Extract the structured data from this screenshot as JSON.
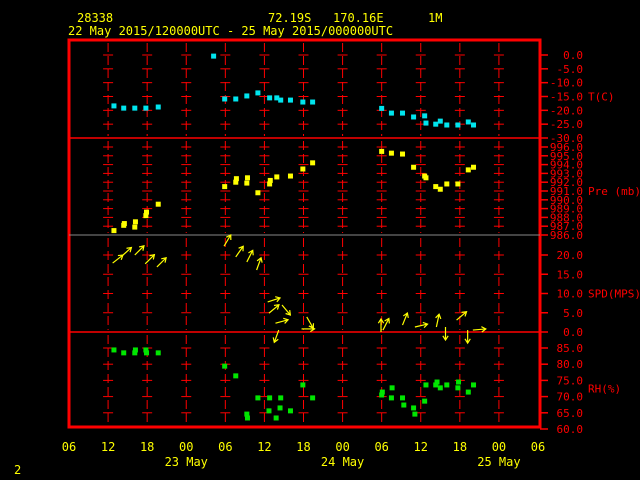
{
  "header": {
    "station": "28338",
    "lat": "72.19S",
    "lon": "170.16E",
    "level": "1M",
    "period": "22 May 2015/120000UTC - 25 May 2015/000000UTC"
  },
  "footer": {
    "page": "2"
  },
  "colors": {
    "frame": "#ff0000",
    "text": "#ffff00",
    "temp": "#00e5ee",
    "pres": "#ffff00",
    "wind": "#ffff00",
    "rh": "#00e600"
  },
  "chart_data": {
    "type": "scatter",
    "x_unit": "hours since 22 May 2015 06UTC",
    "x_range": [
      0,
      72
    ],
    "x_tick_labels": [
      "06",
      "12",
      "18",
      "00",
      "06",
      "12",
      "18",
      "00",
      "06",
      "12",
      "18",
      "00",
      "06"
    ],
    "date_labels": [
      {
        "label": "23 May",
        "hour": 18
      },
      {
        "label": "24 May",
        "hour": 42
      },
      {
        "label": "25 May",
        "hour": 66
      }
    ],
    "panels": [
      {
        "name": "temperature",
        "title": "T(C)",
        "range": [
          -30,
          0
        ],
        "ticks": [
          0,
          -5,
          -10,
          -15,
          -20,
          -25,
          -30
        ],
        "tick_labels": [
          "0.0",
          "-5.0",
          "-10.0",
          "-15.0",
          "-20.0",
          "-25.0",
          "-30.0"
        ],
        "points": [
          [
            6.9,
            -18.4
          ],
          [
            8.4,
            -19.2
          ],
          [
            10.1,
            -19.2
          ],
          [
            11.8,
            -19.2
          ],
          [
            13.7,
            -18.8
          ],
          [
            22.2,
            -0.4
          ],
          [
            23.9,
            -15.9
          ],
          [
            25.6,
            -15.9
          ],
          [
            27.3,
            -14.8
          ],
          [
            29.0,
            -13.7
          ],
          [
            30.8,
            -15.5
          ],
          [
            31.9,
            -15.5
          ],
          [
            32.5,
            -16.3
          ],
          [
            34.0,
            -16.3
          ],
          [
            35.9,
            -17.0
          ],
          [
            37.4,
            -17.0
          ],
          [
            48.0,
            -19.3
          ],
          [
            49.5,
            -21.0
          ],
          [
            51.2,
            -21.0
          ],
          [
            52.9,
            -22.4
          ],
          [
            54.6,
            -22.0
          ],
          [
            54.8,
            -24.6
          ],
          [
            56.3,
            -25.0
          ],
          [
            57.0,
            -23.9
          ],
          [
            58.0,
            -25.3
          ],
          [
            59.7,
            -25.3
          ],
          [
            61.3,
            -24.2
          ],
          [
            62.1,
            -25.3
          ]
        ]
      },
      {
        "name": "pressure",
        "title": "Pre (mb)",
        "range": [
          986,
          996
        ],
        "ticks": [
          996,
          995,
          994,
          993,
          992,
          991,
          990,
          989,
          988,
          987,
          986
        ],
        "tick_labels": [
          "996.0",
          "995.0",
          "994.0",
          "993.0",
          "992.0",
          "991.0",
          "990.0",
          "989.0",
          "988.0",
          "987.0",
          "986.0"
        ],
        "points": [
          [
            6.9,
            986.5
          ],
          [
            8.4,
            987.1
          ],
          [
            8.5,
            987.3
          ],
          [
            10.1,
            986.9
          ],
          [
            10.2,
            987.5
          ],
          [
            11.8,
            988.2
          ],
          [
            11.9,
            988.6
          ],
          [
            13.7,
            989.5
          ],
          [
            23.9,
            991.5
          ],
          [
            25.6,
            992.0
          ],
          [
            25.7,
            992.4
          ],
          [
            27.3,
            991.9
          ],
          [
            27.4,
            992.5
          ],
          [
            29.0,
            990.8
          ],
          [
            30.8,
            991.8
          ],
          [
            30.9,
            992.2
          ],
          [
            31.9,
            992.6
          ],
          [
            34.0,
            992.7
          ],
          [
            35.9,
            993.5
          ],
          [
            37.4,
            994.2
          ],
          [
            48.0,
            995.5
          ],
          [
            49.5,
            995.3
          ],
          [
            51.2,
            995.2
          ],
          [
            52.9,
            993.7
          ],
          [
            54.6,
            992.7
          ],
          [
            54.8,
            992.5
          ],
          [
            56.3,
            991.5
          ],
          [
            57.0,
            991.2
          ],
          [
            58.0,
            991.8
          ],
          [
            59.7,
            991.8
          ],
          [
            61.3,
            993.4
          ],
          [
            62.1,
            993.7
          ]
        ]
      },
      {
        "name": "wind",
        "title": "SPD(MPS)",
        "range": [
          0,
          20
        ],
        "ticks": [
          20,
          15,
          10,
          5,
          0
        ],
        "tick_labels": [
          "20.0",
          "15.0",
          "10.0",
          "5.0",
          "0.0"
        ],
        "points_hour_speed_towarddeg": [
          [
            6.7,
            17.9,
            52
          ],
          [
            8.1,
            19.7,
            48
          ],
          [
            10.1,
            20.0,
            45
          ],
          [
            11.7,
            17.7,
            45
          ],
          [
            13.5,
            16.9,
            45
          ],
          [
            23.8,
            22.3,
            31
          ],
          [
            25.6,
            19.5,
            35
          ],
          [
            27.3,
            18.2,
            27
          ],
          [
            28.8,
            16.1,
            20
          ],
          [
            30.5,
            7.8,
            72
          ],
          [
            30.7,
            4.9,
            50
          ],
          [
            32.7,
            7.0,
            140
          ],
          [
            31.7,
            2.3,
            75
          ],
          [
            32.2,
            0.5,
            200
          ],
          [
            36.5,
            3.9,
            150
          ],
          [
            35.7,
            0.8,
            90
          ],
          [
            47.9,
            0.0,
            0
          ],
          [
            48.2,
            0.5,
            27
          ],
          [
            51.2,
            1.8,
            22
          ],
          [
            53.1,
            1.3,
            77
          ],
          [
            56.4,
            1.3,
            12
          ],
          [
            59.5,
            3.1,
            50
          ],
          [
            57.8,
            1.3,
            180
          ],
          [
            61.2,
            0.5,
            180
          ],
          [
            62.0,
            0.5,
            85
          ]
        ]
      },
      {
        "name": "humidity",
        "title": "RH(%)",
        "range": [
          60,
          85
        ],
        "ticks": [
          85,
          80,
          75,
          70,
          65,
          60
        ],
        "tick_labels": [
          "85.0",
          "80.0",
          "75.0",
          "70.0",
          "65.0",
          "60.0"
        ],
        "points": [
          [
            6.9,
            84.4
          ],
          [
            8.4,
            83.5
          ],
          [
            10.1,
            83.5
          ],
          [
            10.2,
            84.4
          ],
          [
            11.8,
            84.4
          ],
          [
            11.9,
            83.5
          ],
          [
            13.7,
            83.5
          ],
          [
            23.9,
            79.4
          ],
          [
            25.6,
            76.4
          ],
          [
            27.3,
            64.6
          ],
          [
            27.4,
            63.4
          ],
          [
            29.0,
            69.6
          ],
          [
            30.7,
            65.6
          ],
          [
            30.8,
            69.6
          ],
          [
            31.8,
            63.4
          ],
          [
            32.4,
            66.5
          ],
          [
            32.5,
            69.6
          ],
          [
            34.0,
            65.6
          ],
          [
            35.9,
            73.6
          ],
          [
            37.4,
            69.6
          ],
          [
            48.0,
            70.5
          ],
          [
            48.1,
            71.4
          ],
          [
            49.5,
            69.6
          ],
          [
            49.6,
            72.7
          ],
          [
            51.2,
            69.6
          ],
          [
            51.4,
            67.4
          ],
          [
            52.9,
            66.5
          ],
          [
            53.1,
            64.6
          ],
          [
            54.6,
            68.6
          ],
          [
            54.8,
            73.6
          ],
          [
            56.3,
            73.6
          ],
          [
            56.5,
            74.5
          ],
          [
            57.0,
            72.7
          ],
          [
            58.0,
            73.6
          ],
          [
            59.7,
            72.7
          ],
          [
            59.8,
            74.5
          ],
          [
            61.3,
            71.4
          ],
          [
            62.1,
            73.6
          ]
        ]
      }
    ]
  }
}
